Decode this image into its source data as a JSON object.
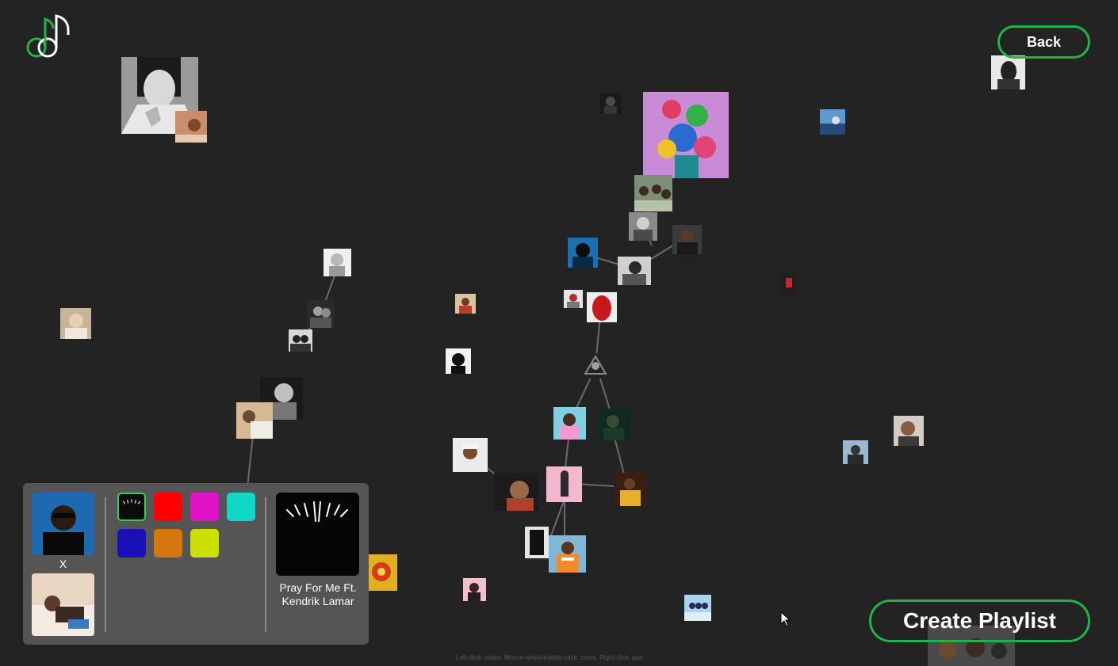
{
  "header": {
    "back_label": "Back",
    "logo_icon": "music-note-logo-icon",
    "accent_color": "#22b24c"
  },
  "footer": {
    "create_playlist_label": "Create Playlist",
    "hint": "Left-click: rotate, Mouse-wheel/middle-click: zoom, Right-click: pan"
  },
  "panel": {
    "left_caption": "X",
    "colors": [
      "#0b0b0b",
      "#ff0000",
      "#e012c8",
      "#12d6c8",
      "#1a10b8",
      "#d4780e",
      "#cce000"
    ],
    "selected_color_index": 0,
    "song_title": "Pray For Me Ft. Kendrik Lamar"
  },
  "graph": {
    "node_count": 44
  }
}
